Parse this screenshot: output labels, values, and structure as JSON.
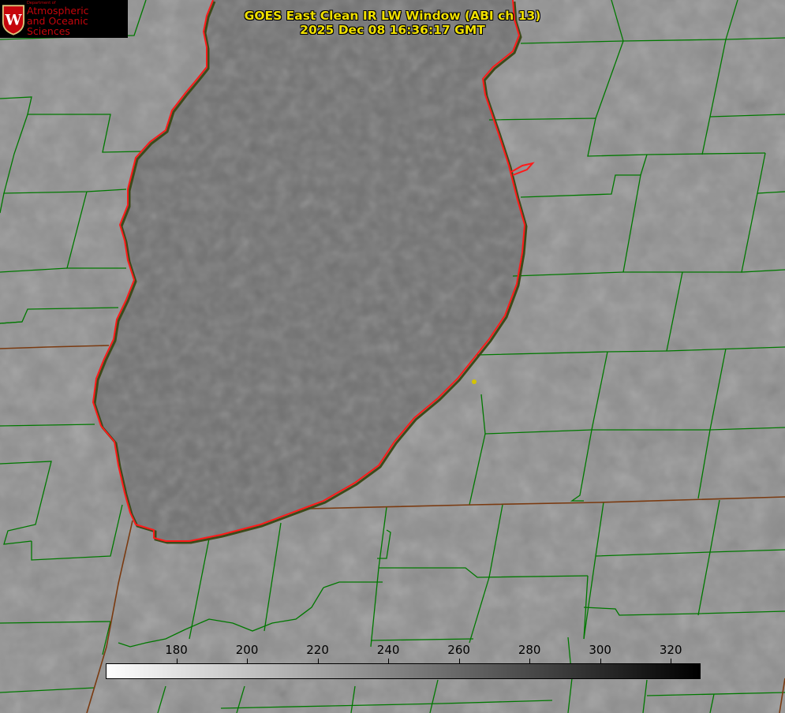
{
  "header": {
    "title_line1": "GOES East Clean IR LW Window (ABI ch 13)",
    "title_line2": "2025 Dec 08 16:36:17 GMT"
  },
  "logo": {
    "dept": "Department of",
    "line1": "Atmospheric",
    "line2": "and Oceanic Sciences",
    "crest_letter": "W"
  },
  "colorbar": {
    "units_min": 160,
    "units_max": 328,
    "ticks": [
      "180",
      "200",
      "220",
      "240",
      "260",
      "280",
      "300",
      "320"
    ],
    "colors": {
      "cold": "#ffffff",
      "warm": "#000000"
    }
  },
  "colors": {
    "land": "#8d8d8d",
    "lake": "#6e6e6e",
    "county_lines": "#007800",
    "lake_outline": "#ff1a1a",
    "state_lines": "#7a3a10",
    "title": "#f0e000",
    "marker": "#d4c400"
  }
}
